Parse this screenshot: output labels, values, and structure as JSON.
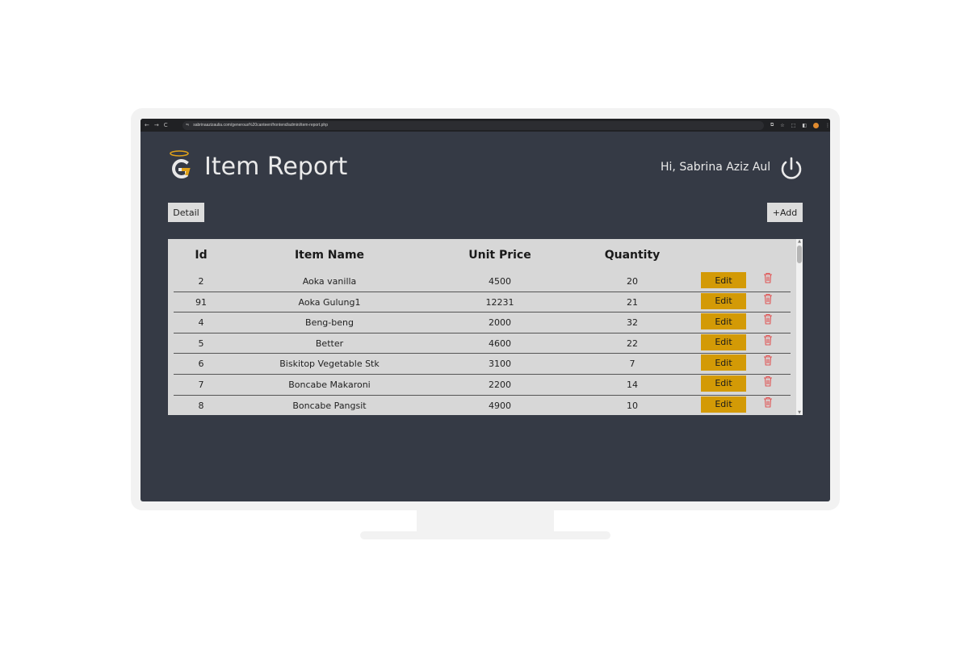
{
  "browser": {
    "url": "sabrinaazizaulia.com/generous%20canteen/frontend/admin/item-report.php",
    "nav_back": "←",
    "nav_forward": "→",
    "nav_reload": "C"
  },
  "header": {
    "title": "Item Report",
    "greeting": "Hi, Sabrina Aziz Aul"
  },
  "toolbar": {
    "detail_label": "Detail",
    "add_label": "+Add"
  },
  "table": {
    "columns": [
      "Id",
      "Item Name",
      "Unit Price",
      "Quantity"
    ],
    "edit_label": "Edit",
    "rows": [
      {
        "id": "2",
        "name": "Aoka vanilla",
        "price": "4500",
        "qty": "20"
      },
      {
        "id": "91",
        "name": "Aoka Gulung1",
        "price": "12231",
        "qty": "21"
      },
      {
        "id": "4",
        "name": "Beng-beng",
        "price": "2000",
        "qty": "32"
      },
      {
        "id": "5",
        "name": "Better",
        "price": "4600",
        "qty": "22"
      },
      {
        "id": "6",
        "name": "Biskitop Vegetable Stk",
        "price": "3100",
        "qty": "7"
      },
      {
        "id": "7",
        "name": "Boncabe Makaroni",
        "price": "2200",
        "qty": "14"
      },
      {
        "id": "8",
        "name": "Boncabe Pangsit",
        "price": "4900",
        "qty": "10"
      }
    ]
  },
  "colors": {
    "background": "#353a45",
    "edit_button": "#d39a06",
    "delete_icon": "#e05555",
    "logo_accent": "#e0a21a"
  }
}
